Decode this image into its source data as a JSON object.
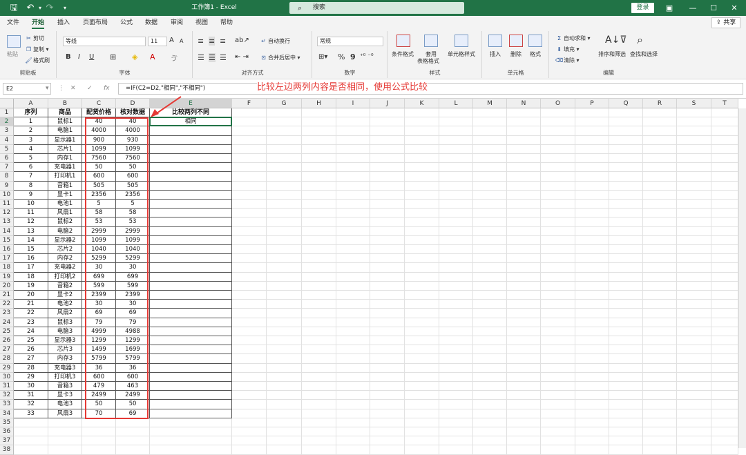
{
  "app": {
    "title": "工作簿1  -  Excel",
    "search": "搜索",
    "login": "登录",
    "share": "共享"
  },
  "menu": [
    "文件",
    "开始",
    "插入",
    "页面布局",
    "公式",
    "数据",
    "审阅",
    "视图",
    "帮助"
  ],
  "ribbon": {
    "clipboard": {
      "paste": "粘贴",
      "cut": "剪切",
      "copy": "复制",
      "painter": "格式刷",
      "label": "剪贴板"
    },
    "font": {
      "name": "等线",
      "size": "11",
      "grow": "A",
      "shrink": "A",
      "bold": "B",
      "italic": "I",
      "underline": "U",
      "label": "字体"
    },
    "align": {
      "wrap": "自动换行",
      "merge": "合并后居中",
      "label": "对齐方式"
    },
    "number": {
      "format": "常规",
      "percent": "%",
      "comma": "9",
      "label": "数字"
    },
    "styles": {
      "cond": "条件格式",
      "table1": "套用",
      "table2": "表格格式",
      "cellstyle": "单元格样式",
      "label": "样式"
    },
    "cells": {
      "insert": "插入",
      "delete": "删除",
      "format": "格式",
      "label": "单元格"
    },
    "edit": {
      "autosum": "自动求和",
      "fill": "填充",
      "clear": "清除",
      "sort": "排序和筛选",
      "find": "查找和选择",
      "label": "编辑"
    }
  },
  "formula_bar": {
    "namebox": "E2",
    "formula": "=IF(C2=D2,\"相同\",\"不相同\")"
  },
  "annotation": "比较左边两列内容是否相同，使用公式比较",
  "columns": [
    "A",
    "B",
    "C",
    "D",
    "E",
    "F",
    "G",
    "H",
    "I",
    "J",
    "K",
    "L",
    "M",
    "N",
    "O",
    "P",
    "Q",
    "R",
    "S",
    "T"
  ],
  "headers": [
    "序列",
    "商品",
    "配货价格",
    "核对数据",
    "比较两列不同"
  ],
  "e2": "相同",
  "rows": [
    [
      "1",
      "鼠标1",
      "40",
      "40"
    ],
    [
      "2",
      "电脑1",
      "4000",
      "4000"
    ],
    [
      "3",
      "显示器1",
      "900",
      "930"
    ],
    [
      "4",
      "芯片1",
      "1099",
      "1099"
    ],
    [
      "5",
      "内存1",
      "7560",
      "7560"
    ],
    [
      "6",
      "充电器1",
      "50",
      "50"
    ],
    [
      "7",
      "打印机1",
      "600",
      "600"
    ],
    [
      "8",
      "音箱1",
      "505",
      "505"
    ],
    [
      "9",
      "显卡1",
      "2356",
      "2356"
    ],
    [
      "10",
      "电池1",
      "5",
      "5"
    ],
    [
      "11",
      "风扇1",
      "58",
      "58"
    ],
    [
      "12",
      "鼠标2",
      "53",
      "53"
    ],
    [
      "13",
      "电脑2",
      "2999",
      "2999"
    ],
    [
      "14",
      "显示器2",
      "1099",
      "1099"
    ],
    [
      "15",
      "芯片2",
      "1040",
      "1040"
    ],
    [
      "16",
      "内存2",
      "5299",
      "5299"
    ],
    [
      "17",
      "充电器2",
      "30",
      "30"
    ],
    [
      "18",
      "打印机2",
      "699",
      "699"
    ],
    [
      "19",
      "音箱2",
      "599",
      "599"
    ],
    [
      "20",
      "显卡2",
      "2399",
      "2399"
    ],
    [
      "21",
      "电池2",
      "30",
      "30"
    ],
    [
      "22",
      "风扇2",
      "69",
      "69"
    ],
    [
      "23",
      "鼠标3",
      "79",
      "79"
    ],
    [
      "24",
      "电脑3",
      "4999",
      "4988"
    ],
    [
      "25",
      "显示器3",
      "1299",
      "1299"
    ],
    [
      "26",
      "芯片3",
      "1499",
      "1699"
    ],
    [
      "27",
      "内存3",
      "5799",
      "5799"
    ],
    [
      "28",
      "充电器3",
      "36",
      "36"
    ],
    [
      "29",
      "打印机3",
      "600",
      "600"
    ],
    [
      "30",
      "音箱3",
      "479",
      "463"
    ],
    [
      "31",
      "显卡3",
      "2499",
      "2499"
    ],
    [
      "32",
      "电池3",
      "50",
      "50"
    ],
    [
      "33",
      "风扇3",
      "70",
      "69"
    ]
  ],
  "row_numbers": [
    "1",
    "2",
    "3",
    "4",
    "5",
    "6",
    "7",
    "8",
    "9",
    "10",
    "11",
    "12",
    "13",
    "14",
    "15",
    "16",
    "17",
    "18",
    "19",
    "20",
    "21",
    "22",
    "23",
    "24",
    "25",
    "26",
    "27",
    "28",
    "29",
    "30",
    "31",
    "32",
    "33",
    "34",
    "35",
    "36",
    "37",
    "38"
  ]
}
